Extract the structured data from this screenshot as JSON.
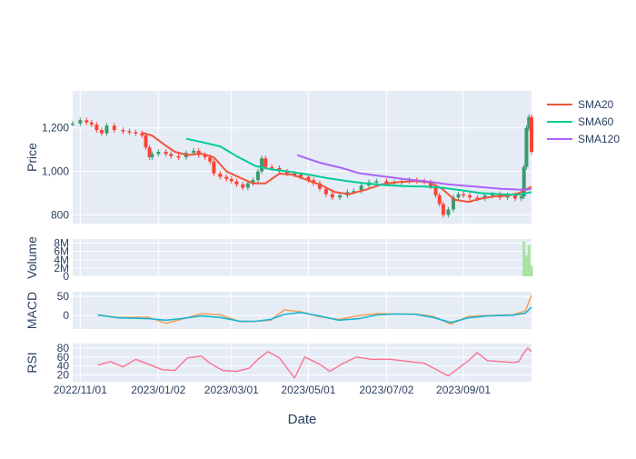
{
  "chart_data": {
    "type": "line",
    "xlabel": "Date",
    "x_ticks": [
      {
        "date": "2022-11-01",
        "label": "2022/11/01"
      },
      {
        "date": "2023-01-02",
        "label": "2023/01/02"
      },
      {
        "date": "2023-03-01",
        "label": "2023/03/01"
      },
      {
        "date": "2023-05-01",
        "label": "2023/05/01"
      },
      {
        "date": "2023-07-02",
        "label": "2023/07/02"
      },
      {
        "date": "2023-09-01",
        "label": "2023/09/01"
      }
    ],
    "x_range": [
      "2022-10-26",
      "2023-10-25"
    ],
    "legend": {
      "position": "top-right",
      "entries": [
        {
          "name": "SMA20",
          "color": "#ef553b"
        },
        {
          "name": "SMA60",
          "color": "#00cc96"
        },
        {
          "name": "SMA120",
          "color": "#ab63fa"
        }
      ]
    },
    "colors": {
      "increasing": "#3d9970",
      "decreasing": "#ff4136",
      "volume": "#a6e3a1",
      "macd": "#19b6d2",
      "signal": "#f4a261",
      "rsi": "#ff6f91",
      "panel_bg": "#e5ecf6",
      "grid": "#ffffff"
    },
    "panels": {
      "price": {
        "ylabel": "Price",
        "ylim": [
          760,
          1370
        ],
        "yticks": [
          800,
          1000,
          1200
        ],
        "ytick_labels": [
          "800",
          "1,000",
          "1,200"
        ]
      },
      "volume": {
        "ylabel": "Volume",
        "ylim": [
          0,
          9000000
        ],
        "yticks": [
          0,
          2000000,
          4000000,
          6000000,
          8000000
        ],
        "ytick_labels": [
          "0",
          "2M",
          "4M",
          "6M",
          "8M"
        ]
      },
      "macd": {
        "ylabel": "MACD",
        "ylim": [
          -35,
          62
        ],
        "yticks": [
          0,
          50
        ],
        "ytick_labels": [
          "0",
          "50"
        ]
      },
      "rsi": {
        "ylabel": "RSI",
        "ylim": [
          5,
          90
        ],
        "yticks": [
          20,
          40,
          60,
          80
        ],
        "ytick_labels": [
          "20",
          "40",
          "60",
          "80"
        ]
      }
    },
    "candles_approx": [
      [
        "2022-10-26",
        1220
      ],
      [
        "2022-11-01",
        1235
      ],
      [
        "2022-11-06",
        1225
      ],
      [
        "2022-11-10",
        1215
      ],
      [
        "2022-11-14",
        1190
      ],
      [
        "2022-11-18",
        1175
      ],
      [
        "2022-11-22",
        1210
      ],
      [
        "2022-11-28",
        1190
      ],
      [
        "2022-12-05",
        1185
      ],
      [
        "2022-12-10",
        1180
      ],
      [
        "2022-12-15",
        1175
      ],
      [
        "2022-12-20",
        1165
      ],
      [
        "2022-12-23",
        1110
      ],
      [
        "2022-12-26",
        1065
      ],
      [
        "2022-12-28",
        1080
      ],
      [
        "2023-01-02",
        1090
      ],
      [
        "2023-01-08",
        1080
      ],
      [
        "2023-01-12",
        1070
      ],
      [
        "2023-01-18",
        1065
      ],
      [
        "2023-01-24",
        1085
      ],
      [
        "2023-01-30",
        1095
      ],
      [
        "2023-02-03",
        1075
      ],
      [
        "2023-02-08",
        1065
      ],
      [
        "2023-02-12",
        1045
      ],
      [
        "2023-02-15",
        990
      ],
      [
        "2023-02-20",
        975
      ],
      [
        "2023-02-25",
        965
      ],
      [
        "2023-03-01",
        955
      ],
      [
        "2023-03-05",
        940
      ],
      [
        "2023-03-10",
        925
      ],
      [
        "2023-03-14",
        945
      ],
      [
        "2023-03-18",
        960
      ],
      [
        "2023-03-22",
        1000
      ],
      [
        "2023-03-25",
        1060
      ],
      [
        "2023-03-28",
        1020
      ],
      [
        "2023-04-02",
        1015
      ],
      [
        "2023-04-08",
        1000
      ],
      [
        "2023-04-14",
        990
      ],
      [
        "2023-04-20",
        985
      ],
      [
        "2023-04-25",
        975
      ],
      [
        "2023-05-01",
        960
      ],
      [
        "2023-05-05",
        945
      ],
      [
        "2023-05-10",
        920
      ],
      [
        "2023-05-15",
        895
      ],
      [
        "2023-05-20",
        880
      ],
      [
        "2023-05-26",
        890
      ],
      [
        "2023-06-01",
        905
      ],
      [
        "2023-06-06",
        910
      ],
      [
        "2023-06-12",
        935
      ],
      [
        "2023-06-18",
        950
      ],
      [
        "2023-06-24",
        955
      ],
      [
        "2023-07-02",
        945
      ],
      [
        "2023-07-08",
        950
      ],
      [
        "2023-07-14",
        955
      ],
      [
        "2023-07-20",
        960
      ],
      [
        "2023-07-26",
        955
      ],
      [
        "2023-08-01",
        950
      ],
      [
        "2023-08-06",
        930
      ],
      [
        "2023-08-10",
        890
      ],
      [
        "2023-08-13",
        850
      ],
      [
        "2023-08-16",
        800
      ],
      [
        "2023-08-20",
        825
      ],
      [
        "2023-08-24",
        880
      ],
      [
        "2023-08-28",
        895
      ],
      [
        "2023-09-01",
        890
      ],
      [
        "2023-09-06",
        880
      ],
      [
        "2023-09-12",
        875
      ],
      [
        "2023-09-18",
        890
      ],
      [
        "2023-09-24",
        895
      ],
      [
        "2023-09-30",
        880
      ],
      [
        "2023-10-06",
        890
      ],
      [
        "2023-10-12",
        875
      ],
      [
        "2023-10-17",
        885
      ],
      [
        "2023-10-19",
        1020
      ],
      [
        "2023-10-21",
        1200
      ],
      [
        "2023-10-23",
        1250
      ],
      [
        "2023-10-25",
        1090
      ]
    ],
    "series": [
      {
        "name": "SMA20",
        "points": [
          [
            "2022-12-20",
            1178
          ],
          [
            "2022-12-28",
            1165
          ],
          [
            "2023-01-05",
            1130
          ],
          [
            "2023-01-15",
            1090
          ],
          [
            "2023-01-25",
            1075
          ],
          [
            "2023-02-05",
            1082
          ],
          [
            "2023-02-15",
            1065
          ],
          [
            "2023-02-25",
            1000
          ],
          [
            "2023-03-08",
            970
          ],
          [
            "2023-03-18",
            945
          ],
          [
            "2023-03-28",
            945
          ],
          [
            "2023-04-08",
            990
          ],
          [
            "2023-04-18",
            985
          ],
          [
            "2023-04-28",
            965
          ],
          [
            "2023-05-10",
            940
          ],
          [
            "2023-05-22",
            905
          ],
          [
            "2023-06-02",
            895
          ],
          [
            "2023-06-15",
            915
          ],
          [
            "2023-06-28",
            940
          ],
          [
            "2023-07-10",
            950
          ],
          [
            "2023-07-25",
            955
          ],
          [
            "2023-08-05",
            950
          ],
          [
            "2023-08-15",
            920
          ],
          [
            "2023-08-25",
            870
          ],
          [
            "2023-09-05",
            860
          ],
          [
            "2023-09-15",
            875
          ],
          [
            "2023-09-25",
            885
          ],
          [
            "2023-10-05",
            888
          ],
          [
            "2023-10-15",
            900
          ],
          [
            "2023-10-25",
            930
          ]
        ]
      },
      {
        "name": "SMA60",
        "points": [
          [
            "2023-01-24",
            1150
          ],
          [
            "2023-02-05",
            1135
          ],
          [
            "2023-02-20",
            1115
          ],
          [
            "2023-03-05",
            1070
          ],
          [
            "2023-03-20",
            1025
          ],
          [
            "2023-04-01",
            1010
          ],
          [
            "2023-04-15",
            1000
          ],
          [
            "2023-05-01",
            985
          ],
          [
            "2023-05-15",
            970
          ],
          [
            "2023-06-01",
            955
          ],
          [
            "2023-06-15",
            945
          ],
          [
            "2023-07-01",
            937
          ],
          [
            "2023-07-15",
            932
          ],
          [
            "2023-08-01",
            930
          ],
          [
            "2023-08-15",
            925
          ],
          [
            "2023-09-01",
            912
          ],
          [
            "2023-09-15",
            900
          ],
          [
            "2023-10-01",
            895
          ],
          [
            "2023-10-15",
            893
          ],
          [
            "2023-10-25",
            905
          ]
        ]
      },
      {
        "name": "SMA120",
        "points": [
          [
            "2023-04-22",
            1075
          ],
          [
            "2023-05-10",
            1040
          ],
          [
            "2023-05-28",
            1015
          ],
          [
            "2023-06-10",
            992
          ],
          [
            "2023-06-25",
            980
          ],
          [
            "2023-07-15",
            965
          ],
          [
            "2023-08-01",
            955
          ],
          [
            "2023-08-20",
            940
          ],
          [
            "2023-09-10",
            930
          ],
          [
            "2023-10-01",
            920
          ],
          [
            "2023-10-20",
            915
          ],
          [
            "2023-10-25",
            920
          ]
        ]
      }
    ],
    "volume": {
      "points": [
        [
          "2023-10-19",
          8400000
        ],
        [
          "2023-10-21",
          5000000
        ],
        [
          "2023-10-23",
          7500000
        ],
        [
          "2023-10-25",
          2500000
        ]
      ]
    },
    "macd": {
      "name": "MACD",
      "points": [
        [
          "2022-11-15",
          2
        ],
        [
          "2022-12-01",
          -6
        ],
        [
          "2022-12-25",
          -8
        ],
        [
          "2023-01-08",
          -12
        ],
        [
          "2023-01-20",
          -8
        ],
        [
          "2023-02-05",
          -1
        ],
        [
          "2023-02-20",
          -5
        ],
        [
          "2023-03-08",
          -15
        ],
        [
          "2023-03-20",
          -15
        ],
        [
          "2023-04-01",
          -10
        ],
        [
          "2023-04-12",
          3
        ],
        [
          "2023-04-25",
          8
        ],
        [
          "2023-05-10",
          -1
        ],
        [
          "2023-05-25",
          -12
        ],
        [
          "2023-06-10",
          -8
        ],
        [
          "2023-06-25",
          2
        ],
        [
          "2023-07-10",
          4
        ],
        [
          "2023-07-25",
          3
        ],
        [
          "2023-08-08",
          -5
        ],
        [
          "2023-08-22",
          -18
        ],
        [
          "2023-09-05",
          -6
        ],
        [
          "2023-09-20",
          -1
        ],
        [
          "2023-10-10",
          1
        ],
        [
          "2023-10-20",
          6
        ],
        [
          "2023-10-25",
          22
        ]
      ]
    },
    "signal": {
      "name": "Signal",
      "points": [
        [
          "2022-11-15",
          1
        ],
        [
          "2022-12-01",
          -5
        ],
        [
          "2022-12-25",
          -4
        ],
        [
          "2023-01-08",
          -20
        ],
        [
          "2023-01-20",
          -10
        ],
        [
          "2023-02-05",
          5
        ],
        [
          "2023-02-20",
          2
        ],
        [
          "2023-03-08",
          -16
        ],
        [
          "2023-03-20",
          -15
        ],
        [
          "2023-04-01",
          -12
        ],
        [
          "2023-04-12",
          15
        ],
        [
          "2023-04-25",
          10
        ],
        [
          "2023-05-10",
          -3
        ],
        [
          "2023-05-25",
          -10
        ],
        [
          "2023-06-10",
          0
        ],
        [
          "2023-06-25",
          5
        ],
        [
          "2023-07-10",
          4
        ],
        [
          "2023-07-25",
          4
        ],
        [
          "2023-08-08",
          -2
        ],
        [
          "2023-08-22",
          -22
        ],
        [
          "2023-09-05",
          -2
        ],
        [
          "2023-09-20",
          0
        ],
        [
          "2023-10-10",
          2
        ],
        [
          "2023-10-20",
          12
        ],
        [
          "2023-10-25",
          52
        ]
      ]
    },
    "rsi": {
      "name": "RSI",
      "points": [
        [
          "2022-11-15",
          42
        ],
        [
          "2022-11-25",
          50
        ],
        [
          "2022-12-05",
          38
        ],
        [
          "2022-12-15",
          55
        ],
        [
          "2022-12-25",
          44
        ],
        [
          "2023-01-05",
          32
        ],
        [
          "2023-01-15",
          30
        ],
        [
          "2023-01-25",
          58
        ],
        [
          "2023-02-05",
          62
        ],
        [
          "2023-02-12",
          46
        ],
        [
          "2023-02-22",
          30
        ],
        [
          "2023-03-05",
          28
        ],
        [
          "2023-03-15",
          35
        ],
        [
          "2023-03-22",
          55
        ],
        [
          "2023-03-30",
          72
        ],
        [
          "2023-04-08",
          58
        ],
        [
          "2023-04-20",
          13
        ],
        [
          "2023-04-28",
          60
        ],
        [
          "2023-05-10",
          44
        ],
        [
          "2023-05-18",
          28
        ],
        [
          "2023-05-28",
          45
        ],
        [
          "2023-06-08",
          60
        ],
        [
          "2023-06-20",
          55
        ],
        [
          "2023-07-05",
          55
        ],
        [
          "2023-07-20",
          50
        ],
        [
          "2023-08-01",
          46
        ],
        [
          "2023-08-12",
          30
        ],
        [
          "2023-08-20",
          18
        ],
        [
          "2023-08-28",
          35
        ],
        [
          "2023-09-05",
          52
        ],
        [
          "2023-09-12",
          70
        ],
        [
          "2023-09-20",
          52
        ],
        [
          "2023-10-01",
          50
        ],
        [
          "2023-10-10",
          48
        ],
        [
          "2023-10-15",
          50
        ],
        [
          "2023-10-19",
          70
        ],
        [
          "2023-10-22",
          80
        ],
        [
          "2023-10-25",
          72
        ]
      ]
    }
  }
}
